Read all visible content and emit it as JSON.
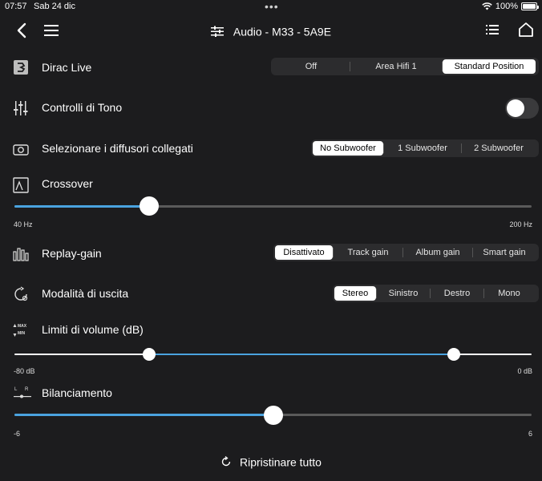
{
  "status_bar": {
    "time": "07:57",
    "date": "Sab 24 dic",
    "battery": "100%"
  },
  "header": {
    "title": "Audio - M33 - 5A9E"
  },
  "dirac": {
    "label": "Dirac Live",
    "options": [
      "Off",
      "Area Hifi 1",
      "Standard Position"
    ],
    "selected": "Standard Position"
  },
  "tone": {
    "label": "Controlli di Tono",
    "enabled": false
  },
  "speakers": {
    "label": "Selezionare i diffusori collegati",
    "options": [
      "No Subwoofer",
      "1 Subwoofer",
      "2 Subwoofer"
    ],
    "selected": "No Subwoofer"
  },
  "crossover": {
    "label": "Crossover",
    "min_label": "40 Hz",
    "max_label": "200 Hz",
    "value_fraction": 0.26
  },
  "replay_gain": {
    "label": "Replay-gain",
    "options": [
      "Disattivato",
      "Track gain",
      "Album gain",
      "Smart gain"
    ],
    "selected": "Disattivato"
  },
  "output_mode": {
    "label": "Modalità di uscita",
    "options": [
      "Stereo",
      "Sinistro",
      "Destro",
      "Mono"
    ],
    "selected": "Stereo"
  },
  "volume_limits": {
    "label": "Limiti di volume (dB)",
    "icon_text_max": "MAX",
    "icon_text_min": "MIN",
    "min_label": "-80 dB",
    "max_label": "0 dB",
    "low_fraction": 0.26,
    "high_fraction": 0.85
  },
  "balance": {
    "label": "Bilanciamento",
    "icon_text_l": "L",
    "icon_text_r": "R",
    "min_label": "-6",
    "max_label": "6",
    "value_fraction": 0.5
  },
  "footer": {
    "reset_label": "Ripristinare tutto"
  },
  "colors": {
    "accent": "#4aa3df",
    "background": "#1c1c1e",
    "segment_bg": "#2c2c2e"
  }
}
